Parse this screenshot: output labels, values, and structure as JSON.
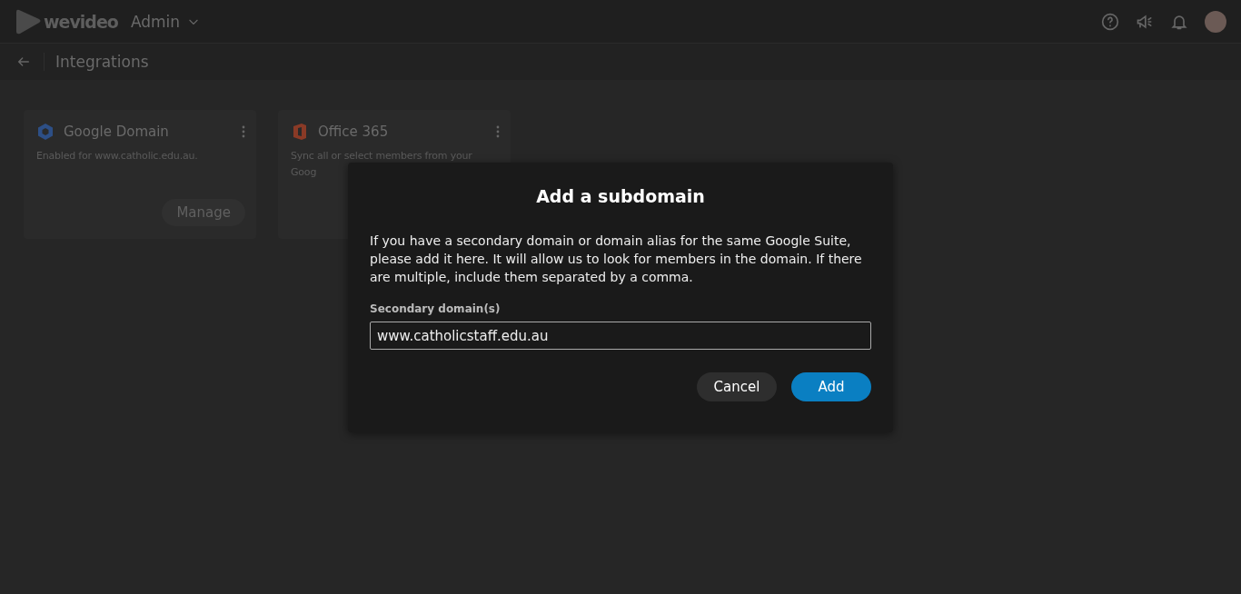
{
  "topbar": {
    "logo": "wevideo",
    "section": "Admin"
  },
  "page": {
    "title": "Integrations"
  },
  "cards": [
    {
      "kind": "google",
      "title": "Google Domain",
      "description": "Enabled for www.catholic.edu.au.",
      "button": "Manage"
    },
    {
      "kind": "office",
      "title": "Office 365",
      "description": "Sync all or select members from your Goog"
    }
  ],
  "dialog": {
    "title": "Add a subdomain",
    "text": "If you have a secondary domain or domain alias for the same Google Suite, please add it here. It will allow us to look for members in the domain. If there are multiple, include them separated by a comma.",
    "field_label": "Secondary domain(s)",
    "field_value": "www.catholicstaff.edu.au",
    "buttons": [
      {
        "kind": "secondary",
        "label": "Cancel"
      },
      {
        "kind": "primary",
        "label": "Add"
      }
    ]
  }
}
